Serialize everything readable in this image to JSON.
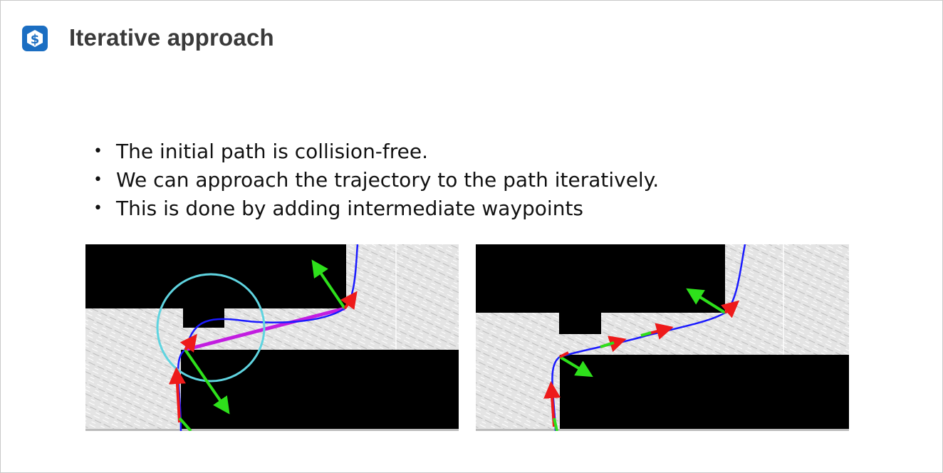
{
  "slide": {
    "title": "Iterative approach",
    "logo_icon": "dollar-badge-icon",
    "bullets": [
      "The initial path is collision-free.",
      "We can approach the trajectory to the path iteratively.",
      "This is done by adding intermediate waypoints"
    ]
  },
  "figures": {
    "left": {
      "description_icons": [
        "obstacle-map",
        "trajectory-curve",
        "waypoint-arrows",
        "search-circle"
      ]
    },
    "right": {
      "description_icons": [
        "obstacle-map",
        "trajectory-curve",
        "intermediate-waypoint-arrows"
      ]
    }
  },
  "colors": {
    "trajectory": "#1a1aff",
    "initial_path": "#c21de0",
    "circle": "#5fd4e0",
    "arrow_green": "#2ee01b",
    "arrow_red": "#ee1a1a",
    "free_space": "#e6e6e6",
    "obstacle": "#000000",
    "logo_blue": "#1b6ec2"
  }
}
